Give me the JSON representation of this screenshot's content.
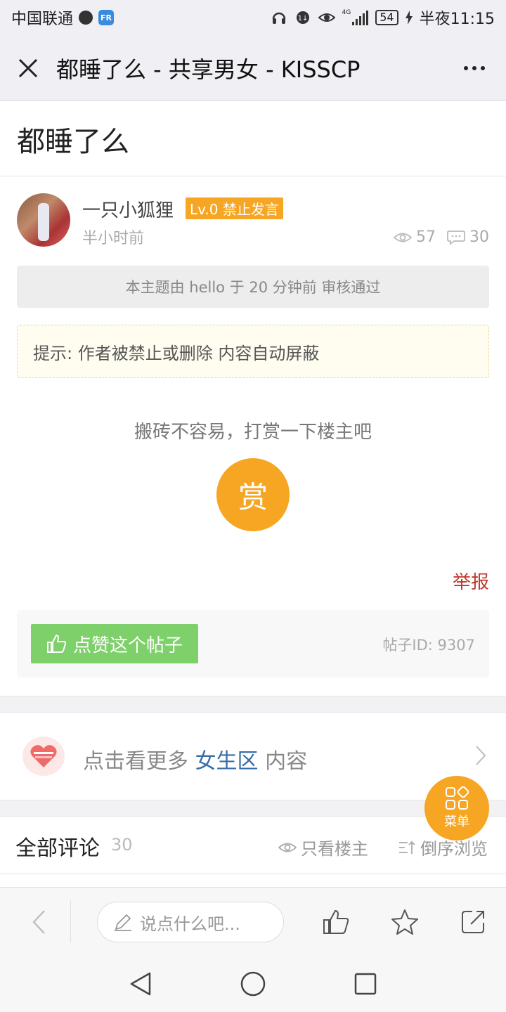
{
  "status_bar": {
    "carrier": "中国联通",
    "fr_badge": "FR",
    "battery": "54",
    "network": "4G",
    "time": "半夜11:15"
  },
  "header": {
    "title": "都睡了么 - 共享男女 - KISSCP",
    "close_icon": "close-icon",
    "more_icon": "more-dots-icon"
  },
  "post": {
    "title": "都睡了么",
    "author": {
      "name": "一只小狐狸",
      "badge": "Lv.0 禁止发言",
      "time": "半小时前"
    },
    "views": "57",
    "comments": "30",
    "review_notice": "本主题由 hello 于 20 分钟前 审核通过",
    "tip": "提示: 作者被禁止或删除 内容自动屏蔽",
    "reward_prompt": "搬砖不容易，打赏一下楼主吧",
    "reward_button": "赏",
    "report": "举报",
    "like_button": "点赞这个帖子",
    "post_id": "帖子ID: 9307"
  },
  "more_section": {
    "prefix": "点击看更多",
    "highlight": "女生区",
    "suffix": "内容"
  },
  "comments_header": {
    "label": "全部评论",
    "count": "30",
    "author_only": "只看楼主",
    "reverse": "倒序浏览"
  },
  "fab": {
    "label": "菜单"
  },
  "toolbar": {
    "input_placeholder": "说点什么吧..."
  },
  "colors": {
    "accent_orange": "#f6a623",
    "like_green": "#7ed06a",
    "report_red": "#c0392b",
    "link_blue": "#3a6ea8"
  }
}
